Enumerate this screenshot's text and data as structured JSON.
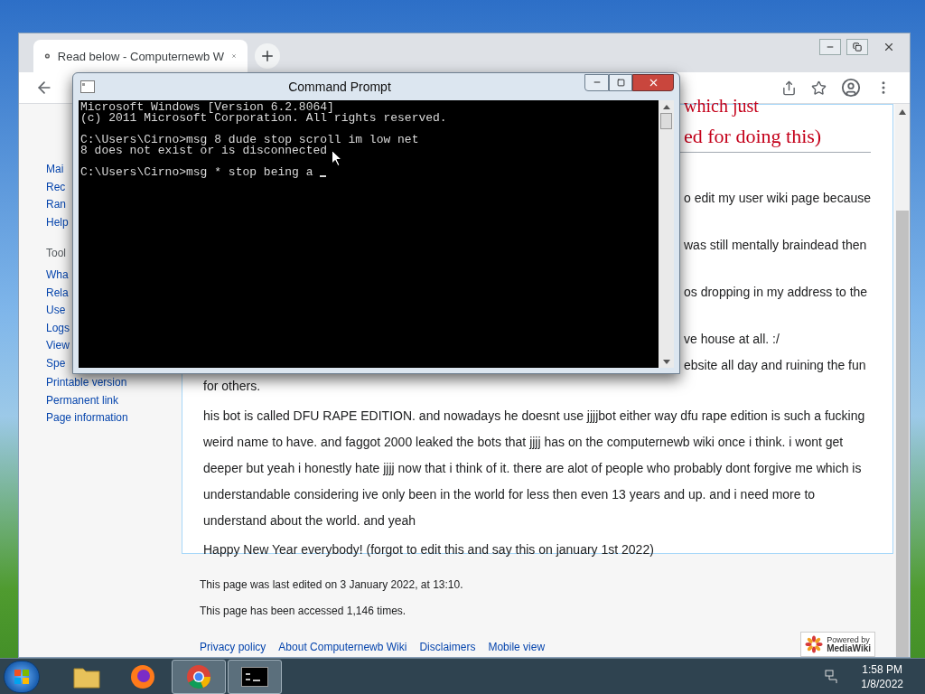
{
  "browser": {
    "tab_title": "Read below - Computernewb W",
    "sidebar": {
      "nav": [
        "Mai",
        "Rec",
        "Ran",
        "Help"
      ],
      "tools_heading": "Tool",
      "tools": [
        "Wha",
        "Rela",
        "Use",
        "Logs",
        "View",
        "Spe",
        "Printable version",
        "Permanent link",
        "Page information"
      ]
    },
    "heading_lines": [
      "which just",
      "ed for doing this)"
    ],
    "fragments": [
      "o edit my user wiki page because",
      "was still mentally braindead then",
      "os dropping in my address to the",
      "ve house at all. :/",
      "ebsite all day and ruining the fun"
    ],
    "continued": "for others.",
    "paragraphs": [
      "his bot is called DFU RAPE EDITION. and nowadays he doesnt use jjjjbot either way dfu rape edition is such a fucking weird name to have. and faggot 2000 leaked the bots that jjjj has on the computernewb wiki once i think. i wont get deeper but yeah i honestly hate jjjj now that i think of it. there are alot of people who probably dont forgive me which is understandable considering ive only been in the world for less then even 13 years and up. and i need more to understand about the world. and yeah",
      "Happy New Year everybody! (forgot to edit this and say this on january 1st 2022)"
    ],
    "footer_info": [
      "This page was last edited on 3 January 2022, at 13:10.",
      "This page has been accessed 1,146 times."
    ],
    "footer_links": [
      "Privacy policy",
      "About Computernewb Wiki",
      "Disclaimers",
      "Mobile view"
    ],
    "powered_by": [
      "Powered by",
      "MediaWiki"
    ]
  },
  "console": {
    "title": "Command Prompt",
    "blocks": [
      [
        "Microsoft Windows [Version 6.2.8064]",
        "(c) 2011 Microsoft Corporation. All rights reserved."
      ],
      [
        "C:\\Users\\Cirno>msg 8 dude stop scroll im low net",
        "8 does not exist or is disconnected"
      ],
      [
        "C:\\Users\\Cirno>msg * stop being a "
      ]
    ]
  },
  "taskbar": {
    "apps": [
      {
        "kind": "folder",
        "running": false
      },
      {
        "kind": "firefox",
        "running": false
      },
      {
        "kind": "chrome",
        "running": true
      },
      {
        "kind": "console",
        "running": true
      }
    ],
    "time": "1:58 PM",
    "date": "1/8/2022"
  }
}
